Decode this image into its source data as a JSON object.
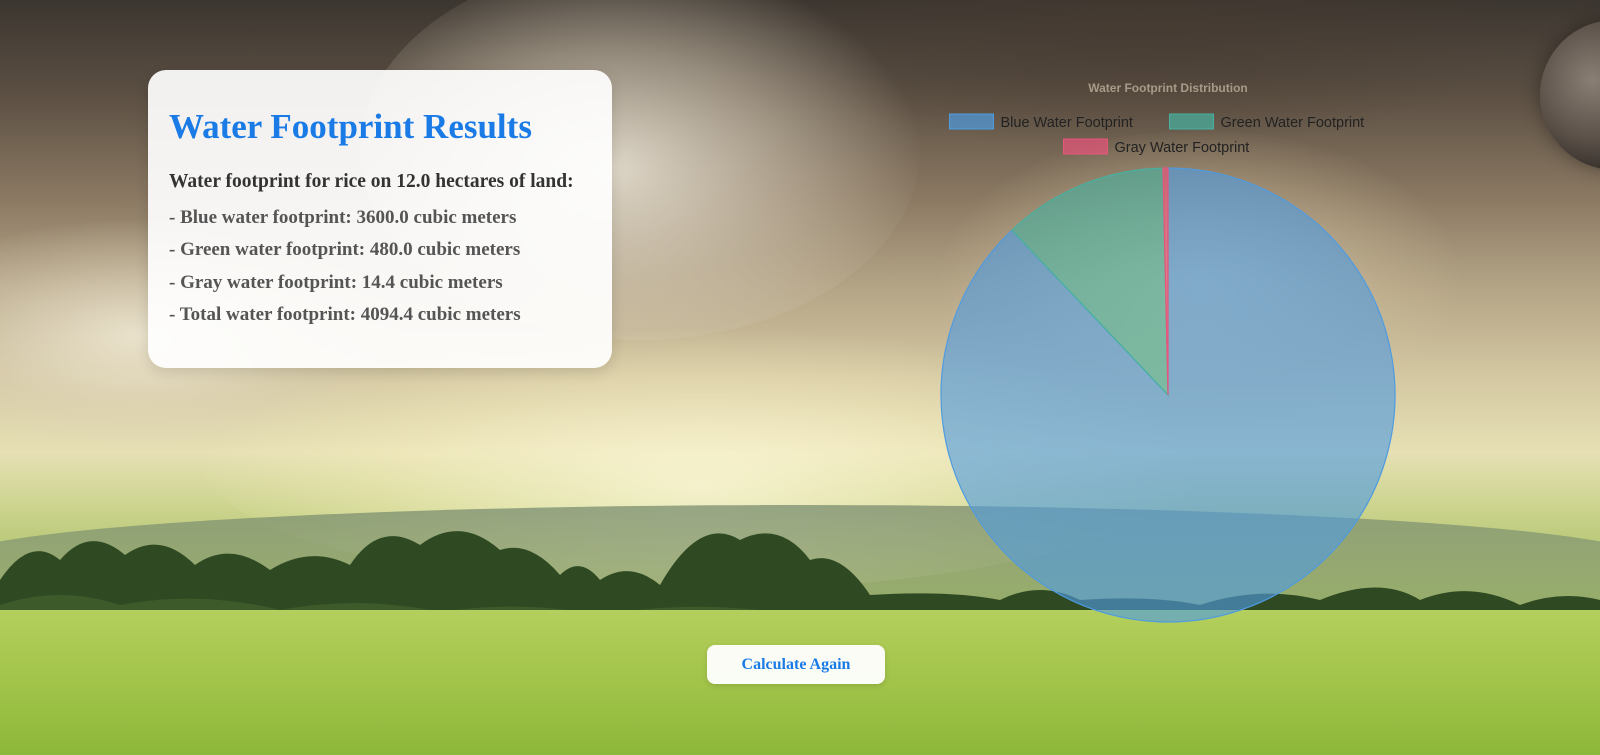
{
  "results": {
    "title": "Water Footprint Results",
    "subtitle": "Water footprint for rice on 12.0 hectares of land:",
    "lines": [
      "- Blue water footprint: 3600.0 cubic meters",
      "- Green water footprint: 480.0 cubic meters",
      "- Gray water footprint: 14.4 cubic meters",
      "- Total water footprint: 4094.4 cubic meters"
    ]
  },
  "actions": {
    "calculate_again_label": "Calculate Again"
  },
  "chart_data": {
    "type": "pie",
    "title": "Water Footprint Distribution",
    "categories": [
      "Blue Water Footprint",
      "Green Water Footprint",
      "Gray Water Footprint"
    ],
    "values": [
      3600.0,
      480.0,
      14.4
    ],
    "colors": [
      "#4f9be0",
      "#47b0a0",
      "#e8547a"
    ],
    "legend_position": "top"
  }
}
